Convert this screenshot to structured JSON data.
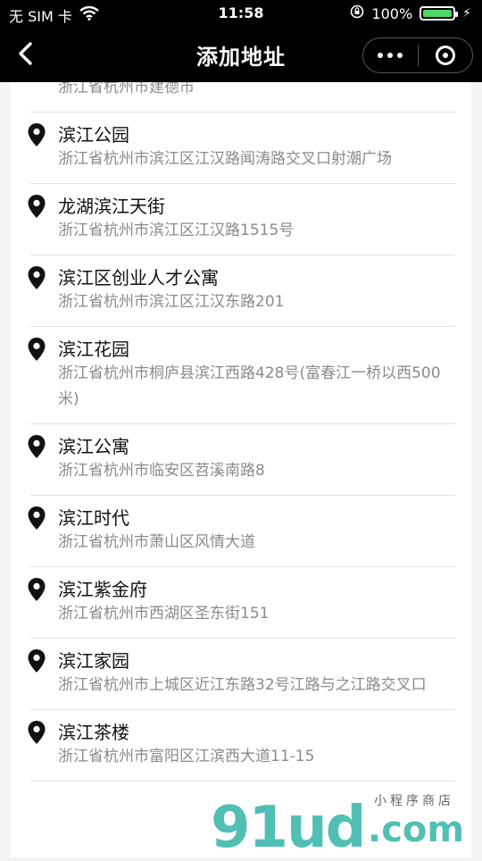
{
  "status": {
    "carrier": "无 SIM 卡",
    "time": "11:58",
    "battery_text": "100%",
    "battery_level": 1.0
  },
  "nav": {
    "title": "添加地址"
  },
  "places": [
    {
      "name": "",
      "address": "浙江省杭州市建德市"
    },
    {
      "name": "滨江公园",
      "address": "浙江省杭州市滨江区江汉路闻涛路交叉口射潮广场"
    },
    {
      "name": "龙湖滨江天街",
      "address": "浙江省杭州市滨江区江汉路1515号"
    },
    {
      "name": "滨江区创业人才公寓",
      "address": "浙江省杭州市滨江区江汉东路201"
    },
    {
      "name": "滨江花园",
      "address": "浙江省杭州市桐庐县滨江西路428号(富春江一桥以西500米)"
    },
    {
      "name": "滨江公寓",
      "address": "浙江省杭州市临安区苕溪南路8"
    },
    {
      "name": "滨江时代",
      "address": "浙江省杭州市萧山区风情大道"
    },
    {
      "name": "滨江紫金府",
      "address": "浙江省杭州市西湖区圣东街151"
    },
    {
      "name": "滨江家园",
      "address": "浙江省杭州市上城区近江东路32号江路与之江路交叉口"
    },
    {
      "name": "滨江茶楼",
      "address": "浙江省杭州市富阳区江滨西大道11-15"
    }
  ],
  "watermark": {
    "brand": "91ud",
    "domain": ".com",
    "tagline": "小程序商店"
  },
  "colors": {
    "bar": "#000000",
    "watermark": "#35b5a8",
    "address": "#8a8a8a"
  }
}
